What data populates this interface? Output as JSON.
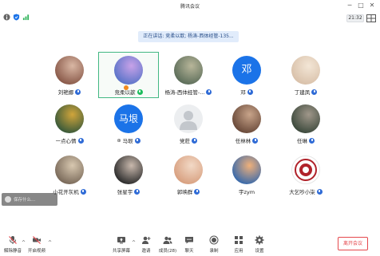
{
  "app": {
    "title": "腾讯会议"
  },
  "window_controls": {
    "minimize": "─",
    "maximize": "□",
    "close": "✕"
  },
  "status": {
    "clock": "21:32"
  },
  "speaking_banner": "正在讲话: 竞柔以歆; 杨涛-西体经管-135...",
  "participants": [
    {
      "name": "刘艳娜",
      "avatar": "photo",
      "colors": [
        "#8a5a4a",
        "#d9b7a4"
      ],
      "mic": "blue"
    },
    {
      "name": "竞柔以歆",
      "avatar": "photo",
      "colors": [
        "#5b74c9",
        "#c8a2e8"
      ],
      "mic": "green",
      "host": true,
      "active": true,
      "speaking": true
    },
    {
      "name": "杨涛-西体经管-...",
      "avatar": "photo",
      "colors": [
        "#5d6e5a",
        "#b8b69a"
      ],
      "mic": "blue"
    },
    {
      "name": "邓",
      "avatar_text": "邓",
      "mic": "blue"
    },
    {
      "name": "丁建凤",
      "avatar": "photo",
      "colors": [
        "#d9c1aa",
        "#f3e6d6"
      ],
      "mic": "blue"
    },
    {
      "name": "一点心情",
      "avatar": "photo",
      "colors": [
        "#3a5a3a",
        "#d1a53b"
      ],
      "mic": "blue"
    },
    {
      "name": "马垠",
      "avatar_text": "马垠",
      "mic": "blue",
      "wechat": true
    },
    {
      "name": "党莊",
      "avatar": "placeholder",
      "mic": "blue"
    },
    {
      "name": "任林林",
      "avatar": "photo",
      "colors": [
        "#6a4a3a",
        "#c8a48a"
      ],
      "mic": "blue"
    },
    {
      "name": "任琳",
      "avatar": "photo",
      "colors": [
        "#3d4a3d",
        "#a0978a"
      ],
      "mic": "blue"
    },
    {
      "name": "小花开灰机",
      "avatar": "photo",
      "colors": [
        "#7a6a5a",
        "#d8c8b0"
      ],
      "mic": "blue"
    },
    {
      "name": "张星宇",
      "avatar": "photo",
      "colors": [
        "#2d2d2d",
        "#c9b9ad"
      ],
      "mic": "blue"
    },
    {
      "name": "郭映群",
      "avatar": "photo",
      "colors": [
        "#d8a080",
        "#f2d9c6"
      ],
      "mic": "blue"
    },
    {
      "name": "宇zym",
      "avatar": "photo",
      "colors": [
        "#3a6aaa",
        "#f0b07a"
      ],
      "mic": null
    },
    {
      "name": "大乞吵小柒",
      "avatar": "seal",
      "colors": [
        "#b0222a",
        "#ffffff"
      ],
      "mic": "blue"
    }
  ],
  "toast": {
    "text": "保存什么..."
  },
  "toolbar": {
    "mute": "解除静音",
    "video": "开启视频",
    "share": "共享屏幕",
    "invite": "邀请",
    "members": "成员(28)",
    "chat": "聊天",
    "record": "录制",
    "apps": "应用",
    "settings": "设置",
    "leave": "离开会议"
  },
  "colors": {
    "accent": "#1b73e8",
    "leave": "#e5484d",
    "active_border": "#42b883"
  }
}
